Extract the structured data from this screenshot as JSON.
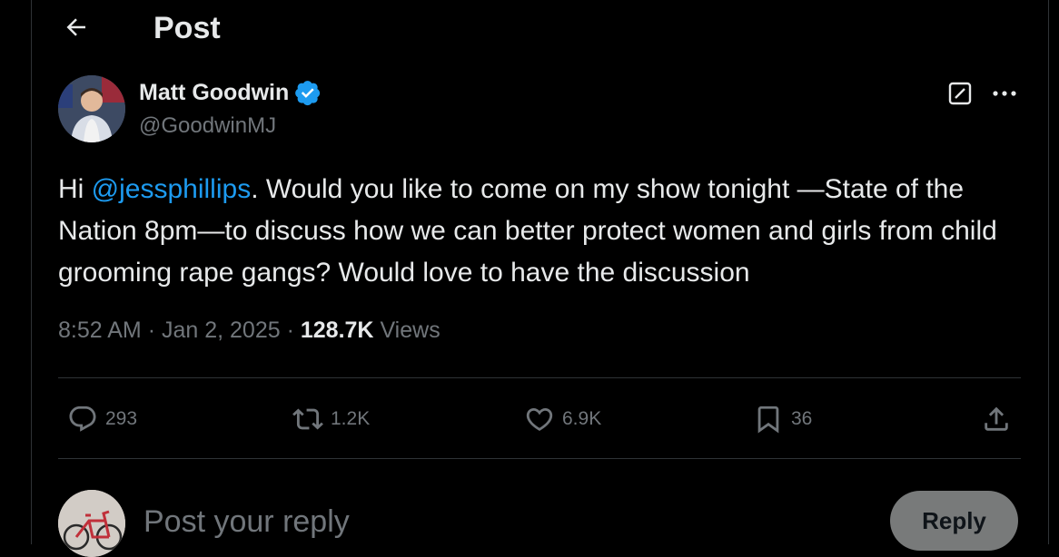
{
  "header": {
    "title": "Post"
  },
  "author": {
    "name": "Matt Goodwin",
    "handle": "@GoodwinMJ"
  },
  "post": {
    "greeting": "Hi ",
    "mention": "@jessphillips",
    "body": ". Would you like to come on my show tonight —State of the Nation 8pm—to discuss how we can better protect women and girls from child grooming rape gangs? Would love to have the discussion",
    "time": "8:52 AM",
    "date": "Jan 2, 2025",
    "separator": "·",
    "views_count": "128.7K",
    "views_label": "Views"
  },
  "actions": {
    "replies": "293",
    "reposts": "1.2K",
    "likes": "6.9K",
    "bookmarks": "36"
  },
  "reply": {
    "placeholder": "Post your reply",
    "button_label": "Reply"
  },
  "colors": {
    "background": "#000000",
    "text": "#e7e9ea",
    "muted": "#71767b",
    "accent": "#1d9bf0",
    "divider": "#2f3336"
  }
}
